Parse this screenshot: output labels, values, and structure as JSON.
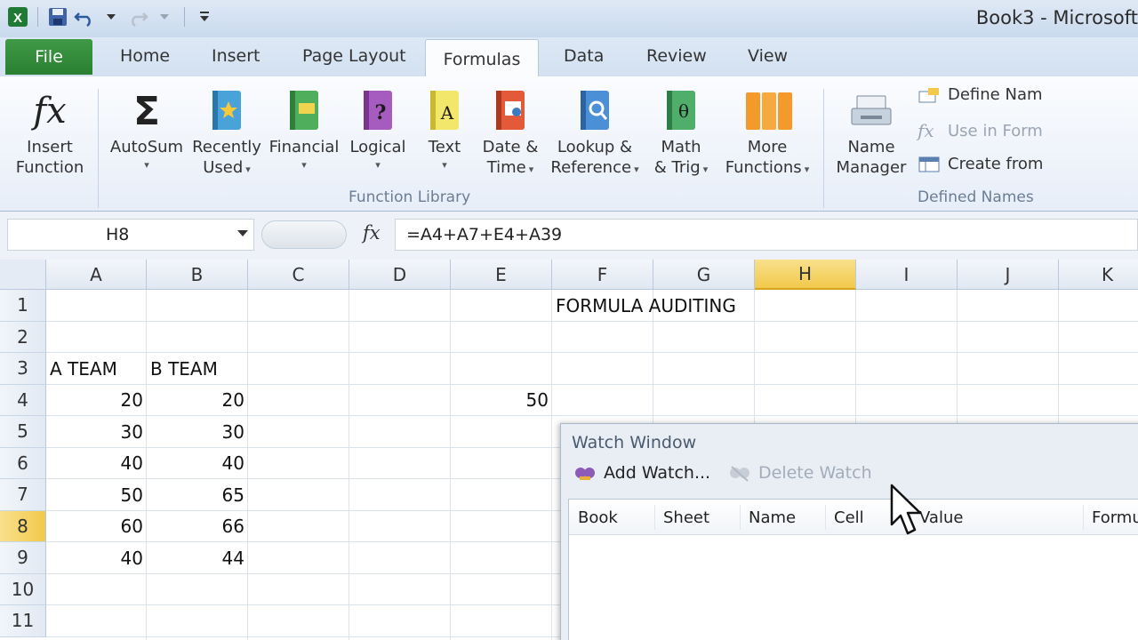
{
  "window": {
    "title": "Book3 - Microsoft"
  },
  "tabs": {
    "file": "File",
    "items": [
      "Home",
      "Insert",
      "Page Layout",
      "Formulas",
      "Data",
      "Review",
      "View"
    ],
    "active": "Formulas"
  },
  "ribbon": {
    "insert_function": {
      "line1": "Insert",
      "line2": "Function"
    },
    "autosum": {
      "line1": "AutoSum"
    },
    "recently_used": {
      "line1": "Recently",
      "line2": "Used"
    },
    "financial": {
      "line1": "Financial"
    },
    "logical": {
      "line1": "Logical"
    },
    "text": {
      "line1": "Text"
    },
    "date_time": {
      "line1": "Date &",
      "line2": "Time"
    },
    "lookup": {
      "line1": "Lookup &",
      "line2": "Reference"
    },
    "math": {
      "line1": "Math",
      "line2": "& Trig"
    },
    "more": {
      "line1": "More",
      "line2": "Functions"
    },
    "function_library_label": "Function Library",
    "name_manager": {
      "line1": "Name",
      "line2": "Manager"
    },
    "define_name": "Define Nam",
    "use_in_formula": "Use in Form",
    "create_from": "Create from",
    "defined_names_label": "Defined Names"
  },
  "formula_bar": {
    "name_box": "H8",
    "fx": "fx",
    "formula": "=A4+A7+E4+A39"
  },
  "grid": {
    "columns": [
      "A",
      "B",
      "C",
      "D",
      "E",
      "F",
      "G",
      "H",
      "I",
      "J",
      "K"
    ],
    "rows": [
      "1",
      "2",
      "3",
      "4",
      "5",
      "6",
      "7",
      "8",
      "9",
      "10",
      "11"
    ],
    "selected_column": "H",
    "selected_row": "8",
    "cells": {
      "F1": "FORMULA AUDITING",
      "A3": "A TEAM",
      "B3": "B TEAM",
      "A4": "20",
      "B4": "20",
      "E4": "50",
      "A5": "30",
      "B5": "30",
      "A6": "40",
      "B6": "40",
      "A7": "50",
      "B7": "65",
      "A8": "60",
      "B8": "66",
      "A9": "40",
      "B9": "44"
    }
  },
  "watch_window": {
    "title": "Watch Window",
    "add_watch": "Add Watch...",
    "delete_watch": "Delete Watch",
    "columns": [
      "Book",
      "Sheet",
      "Name",
      "Cell",
      "Value",
      "Formu"
    ]
  }
}
